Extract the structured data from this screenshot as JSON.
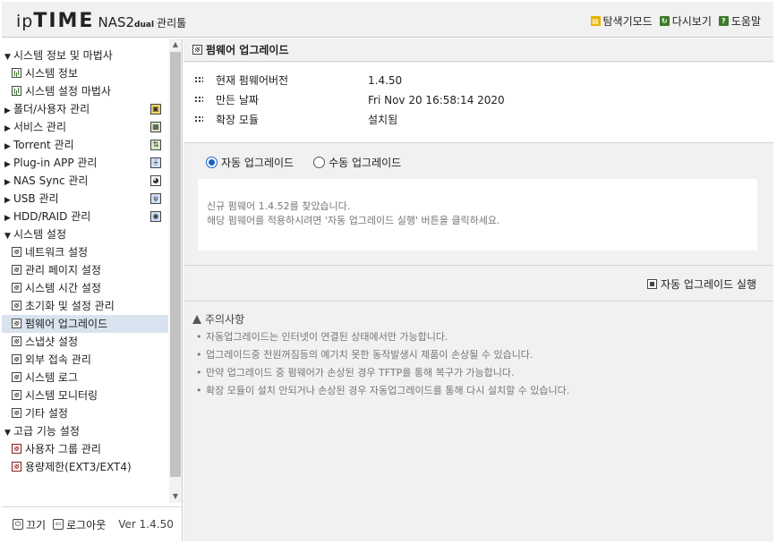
{
  "header": {
    "logo_ip": "ip",
    "logo_time": "TIME",
    "logo_nas": "NAS2",
    "logo_dual": "dual",
    "logo_admin": "관리툴",
    "links": [
      {
        "label": "탐색기모드",
        "icon": "explorer-icon"
      },
      {
        "label": "다시보기",
        "icon": "reload-icon"
      },
      {
        "label": "도움말",
        "icon": "help-icon"
      }
    ]
  },
  "sidebar": {
    "groups": [
      {
        "label": "시스템 정보 및 마법사",
        "expanded": true,
        "items": [
          "시스템 정보",
          "시스템 설정 마법사"
        ]
      },
      {
        "label": "폴더/사용자 관리",
        "expanded": false
      },
      {
        "label": "서비스 관리",
        "expanded": false
      },
      {
        "label": "Torrent 관리",
        "expanded": false
      },
      {
        "label": "Plug-in APP 관리",
        "expanded": false
      },
      {
        "label": "NAS Sync 관리",
        "expanded": false
      },
      {
        "label": "USB 관리",
        "expanded": false
      },
      {
        "label": "HDD/RAID 관리",
        "expanded": false
      },
      {
        "label": "시스템 설정",
        "expanded": true,
        "items": [
          "네트워크 설정",
          "관리 페이지 설정",
          "시스템 시간 설정",
          "초기화 및 설정 관리",
          "펌웨어 업그레이드",
          "스냅샷 설정",
          "외부 접속 관리",
          "시스템 로그",
          "시스템 모니터링",
          "기타 설정"
        ]
      },
      {
        "label": "고급 기능 설정",
        "expanded": true,
        "items": [
          "사용자 그룹 관리",
          "용량제한(EXT3/EXT4)"
        ]
      }
    ],
    "active_item": "펌웨어 업그레이드"
  },
  "footer": {
    "power_label": "끄기",
    "logout_label": "로그아웃",
    "version": "Ver 1.4.50"
  },
  "main": {
    "title": "펌웨어 업그레이드",
    "info": [
      {
        "label": "현재 펌웨어버전",
        "value": "1.4.50"
      },
      {
        "label": "만든 날짜",
        "value": "Fri Nov 20 16:58:14 2020"
      },
      {
        "label": "확장 모듈",
        "value": "설치됨"
      }
    ],
    "radio_auto": "자동 업그레이드",
    "radio_manual": "수동 업그레이드",
    "selected_mode": "auto",
    "notice_line1": "신규 펌웨어 1.4.52를 찾았습니다.",
    "notice_line2": "해당 펌웨어를 적용하시려면 '자동 업그레이드 실행' 버튼을 클릭하세요.",
    "run_button": "자동 업그레이드 실행",
    "caution_title": "주의사항",
    "caution_items": [
      "자동업그레이드는 인터넷이 연결된 상태에서만 가능합니다.",
      "업그레이드중 전원꺼짐등의 예기치 못한 동작발생시 제품이 손상될 수 있습니다.",
      "만약 업그레이드 중 펌웨어가 손상된 경우 TFTP를 통해 복구가 가능합니다.",
      "확장 모듈이 설치 안되거나 손상된 경우 자동업그레이드를 통해 다시 설치할 수 있습니다."
    ]
  }
}
